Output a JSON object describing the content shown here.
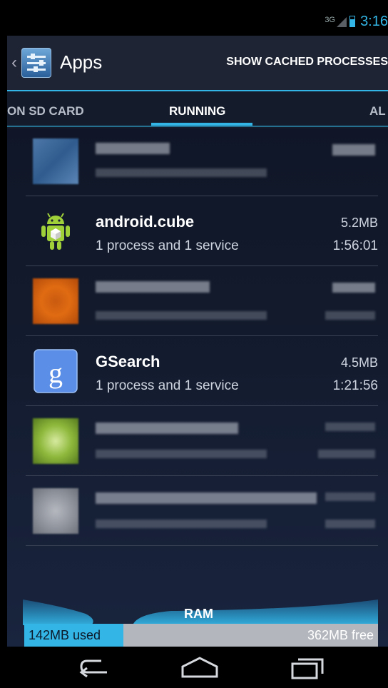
{
  "status_bar": {
    "network": "3G",
    "time": "3:16"
  },
  "action_bar": {
    "title": "Apps",
    "cached_button": "SHOW CACHED PROCESSES"
  },
  "tabs": [
    {
      "label": "ON SD CARD",
      "selected": false
    },
    {
      "label": "RUNNING",
      "selected": true
    },
    {
      "label": "AL",
      "selected": false
    }
  ],
  "apps": [
    {
      "name": "android.cube",
      "description": "1 process and 1 service",
      "size": "5.2MB",
      "time": "1:56:01"
    },
    {
      "name": "GSearch",
      "description": "1 process and 1 service",
      "size": "4.5MB",
      "time": "1:21:56"
    }
  ],
  "ram": {
    "label": "RAM",
    "used": "142MB used",
    "free": "362MB free",
    "used_fraction": 0.28
  },
  "colors": {
    "accent": "#33b5e5"
  }
}
